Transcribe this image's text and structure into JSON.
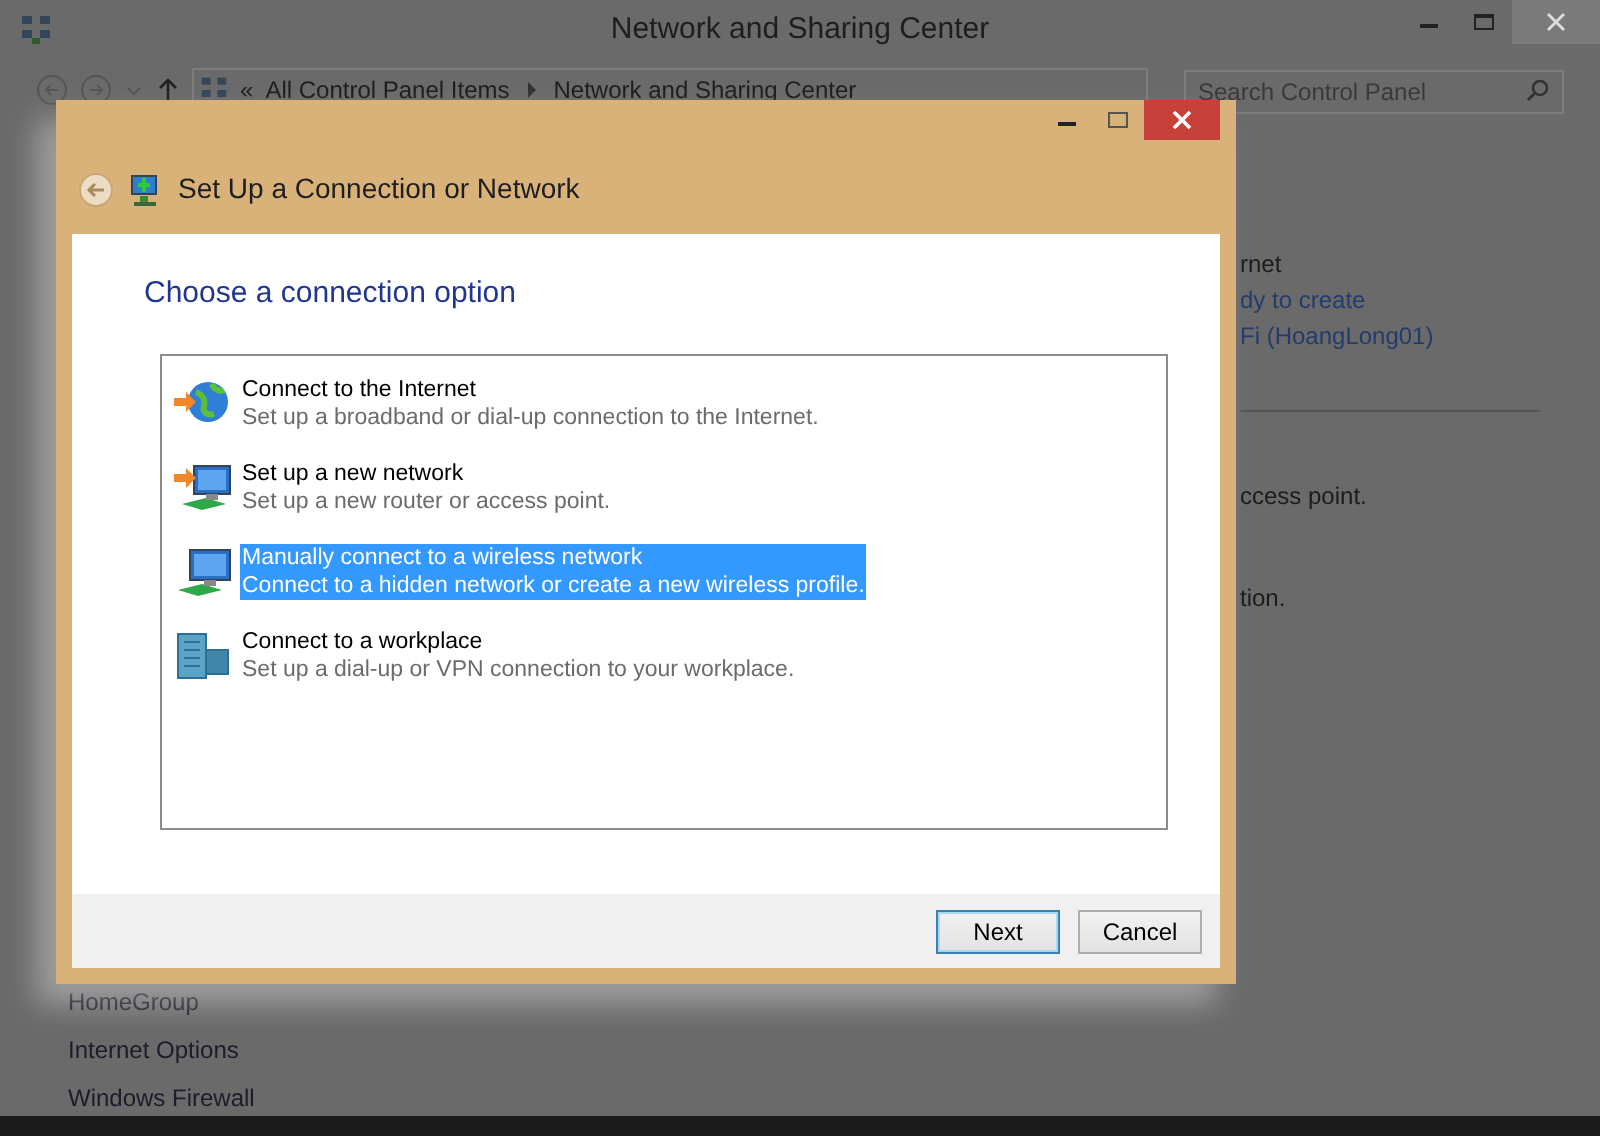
{
  "background_window": {
    "title": "Network and Sharing Center",
    "breadcrumb_prefix": "«",
    "breadcrumb": [
      "All Control Panel Items",
      "Network and Sharing Center"
    ],
    "search": {
      "placeholder": "Search Control Panel"
    },
    "right_pane": [
      {
        "text": "rnet",
        "kind": "text"
      },
      {
        "text": "dy to create",
        "kind": "link"
      },
      {
        "text": "Fi (HoangLong01)",
        "kind": "link"
      },
      {
        "text": "ccess point.",
        "kind": "text"
      },
      {
        "text": "tion.",
        "kind": "text"
      }
    ],
    "left_links": [
      "HomeGroup",
      "Internet Options",
      "Windows Firewall"
    ]
  },
  "dialog": {
    "title": "Set Up a Connection or Network",
    "heading": "Choose a connection option",
    "options": [
      {
        "kind": "globe",
        "title": "Connect to the Internet",
        "description": "Set up a broadband or dial-up connection to the Internet.",
        "selected": false
      },
      {
        "kind": "network",
        "title": "Set up a new network",
        "description": "Set up a new router or access point.",
        "selected": false
      },
      {
        "kind": "wireless",
        "title": "Manually connect to a wireless network",
        "description": "Connect to a hidden network or create a new wireless profile.",
        "selected": true
      },
      {
        "kind": "workplace",
        "title": "Connect to a workplace",
        "description": "Set up a dial-up or VPN connection to your workplace.",
        "selected": false
      }
    ],
    "buttons": [
      {
        "label": "Next",
        "default": true
      },
      {
        "label": "Cancel",
        "default": false
      }
    ]
  }
}
